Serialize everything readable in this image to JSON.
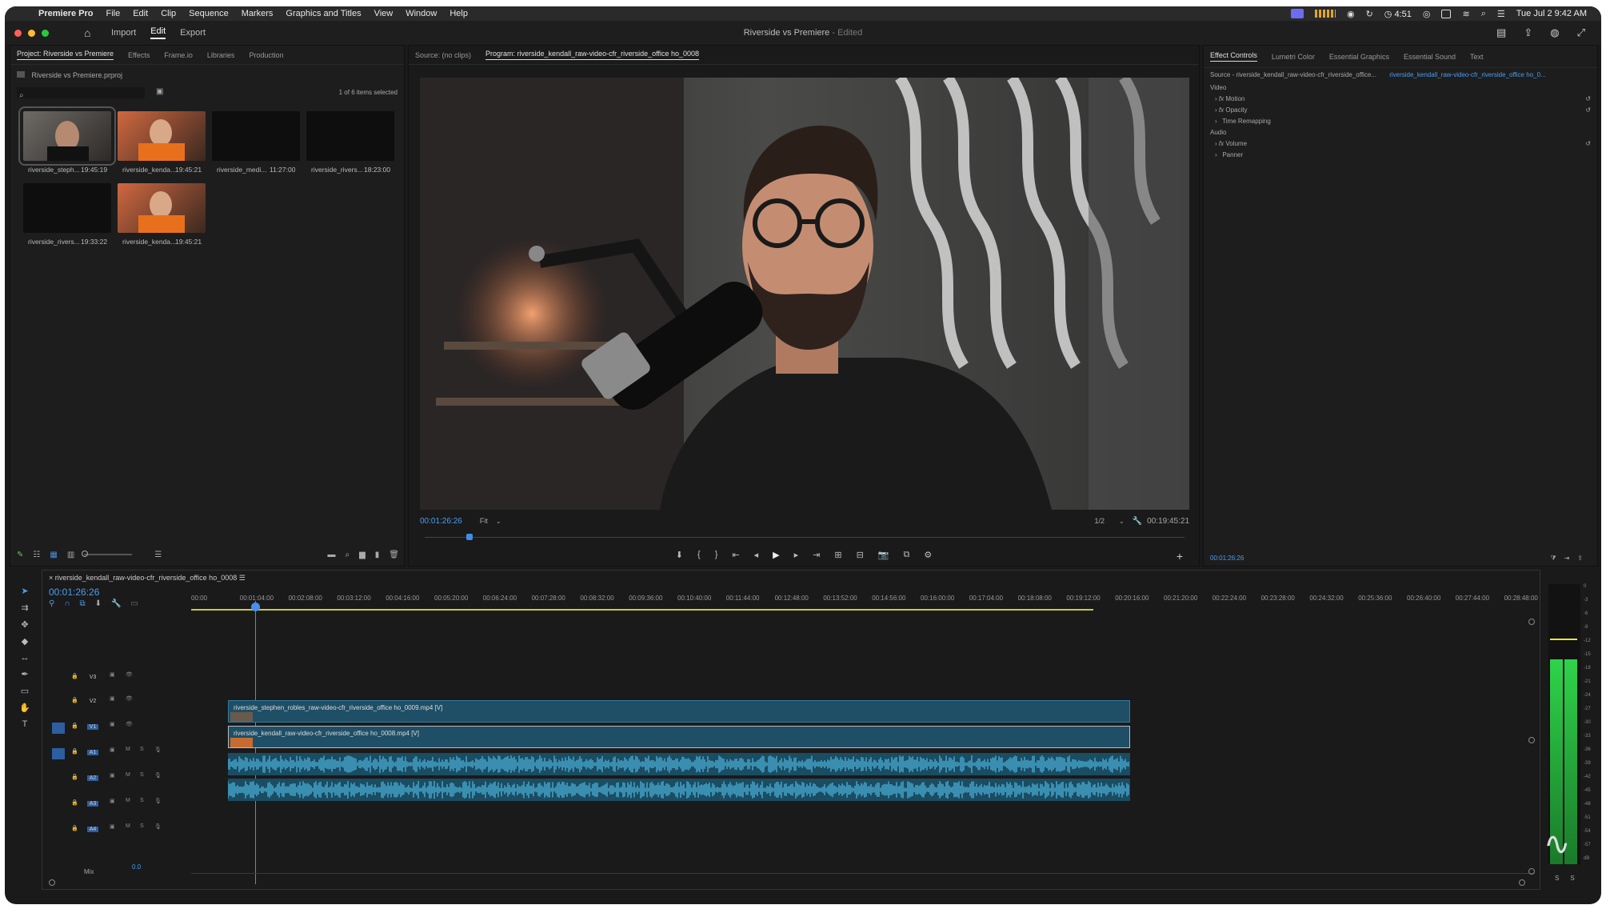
{
  "menubar": {
    "app": "Premiere Pro",
    "items": [
      "File",
      "Edit",
      "Clip",
      "Sequence",
      "Markers",
      "Graphics and Titles",
      "View",
      "Window",
      "Help"
    ],
    "clock_time": "4:51",
    "datetime": "Tue Jul 2  9:42 AM"
  },
  "titlebar": {
    "tabs": [
      "Import",
      "Edit",
      "Export"
    ],
    "active_tab": "Edit",
    "doc_title": "Riverside vs Premiere",
    "doc_status": "- Edited"
  },
  "project": {
    "tabs": [
      "Project: Riverside vs Premiere",
      "Effects",
      "Frame.io",
      "Libraries",
      "Production"
    ],
    "path": "Riverside vs Premiere.prproj",
    "selection": "1 of 6 items selected",
    "items": [
      {
        "name": "riverside_steph...",
        "dur": "19:45:19",
        "kind": "man"
      },
      {
        "name": "riverside_kenda...",
        "dur": "19:45:21",
        "kind": "orange"
      },
      {
        "name": "riverside_medi...",
        "dur": "11:27:00",
        "kind": "black"
      },
      {
        "name": "riverside_rivers...",
        "dur": "18:23:00",
        "kind": "black"
      },
      {
        "name": "riverside_rivers...",
        "dur": "19:33:22",
        "kind": "black"
      },
      {
        "name": "riverside_kenda...",
        "dur": "19:45:21",
        "kind": "orange"
      }
    ]
  },
  "monitor": {
    "source_tab": "Source: (no clips)",
    "program_tab": "Program: riverside_kendall_raw-video-cfr_riverside_office ho_0008",
    "timecode": "00:01:26:26",
    "fit": "Fit",
    "resolution": "1/2",
    "duration": "00:19:45:21"
  },
  "effects": {
    "tabs": [
      "Effect Controls",
      "Lumetri Color",
      "Essential Graphics",
      "Essential Sound",
      "Text"
    ],
    "source": "Source - riverside_kendall_raw-video-cfr_riverside_office...",
    "target": "riverside_kendall_raw-video-cfr_riverside_office ho_0...",
    "video_label": "Video",
    "video_items": [
      "Motion",
      "Opacity",
      "Time Remapping"
    ],
    "audio_label": "Audio",
    "audio_items": [
      "Volume",
      "Panner"
    ],
    "timecode": "00:01:26:26"
  },
  "timeline": {
    "sequence": "riverside_kendall_raw-video-cfr_riverside_office ho_0008",
    "timecode": "00:01:26:26",
    "ruler": [
      "00:00",
      "00:01:04:00",
      "00:02:08:00",
      "00:03:12:00",
      "00:04:16:00",
      "00:05:20:00",
      "00:06:24:00",
      "00:07:28:00",
      "00:08:32:00",
      "00:09:36:00",
      "00:10:40:00",
      "00:11:44:00",
      "00:12:48:00",
      "00:13:52:00",
      "00:14:56:00",
      "00:16:00:00",
      "00:17:04:00",
      "00:18:08:00",
      "00:19:12:00",
      "00:20:16:00",
      "00:21:20:00",
      "00:22:24:00",
      "00:23:28:00",
      "00:24:32:00",
      "00:25:36:00",
      "00:26:40:00",
      "00:27:44:00",
      "00:28:48:00"
    ],
    "video_tracks": [
      "V3",
      "V2",
      "V1"
    ],
    "audio_tracks": [
      "A1",
      "A2",
      "A3",
      "A4"
    ],
    "v2_clip": "riverside_stephen_robles_raw-video-cfr_riverside_office ho_0009.mp4 [V]",
    "v1_clip": "riverside_kendall_raw-video-cfr_riverside_office ho_0008.mp4 [V]",
    "mix_label": "Mix",
    "mix_value": "0.0"
  },
  "meters": {
    "scale": [
      "0",
      "-3",
      "-6",
      "-9",
      "-12",
      "-15",
      "-18",
      "-21",
      "-24",
      "-27",
      "-30",
      "-33",
      "-36",
      "-39",
      "-42",
      "-45",
      "-48",
      "-51",
      "-54",
      "-57",
      "dB"
    ],
    "solo": [
      "S",
      "S"
    ]
  },
  "colors": {
    "accent": "#3d8ee8",
    "clip": "#1f4f66",
    "audio": "#5ad0ff",
    "meter": "#2fd34a"
  }
}
